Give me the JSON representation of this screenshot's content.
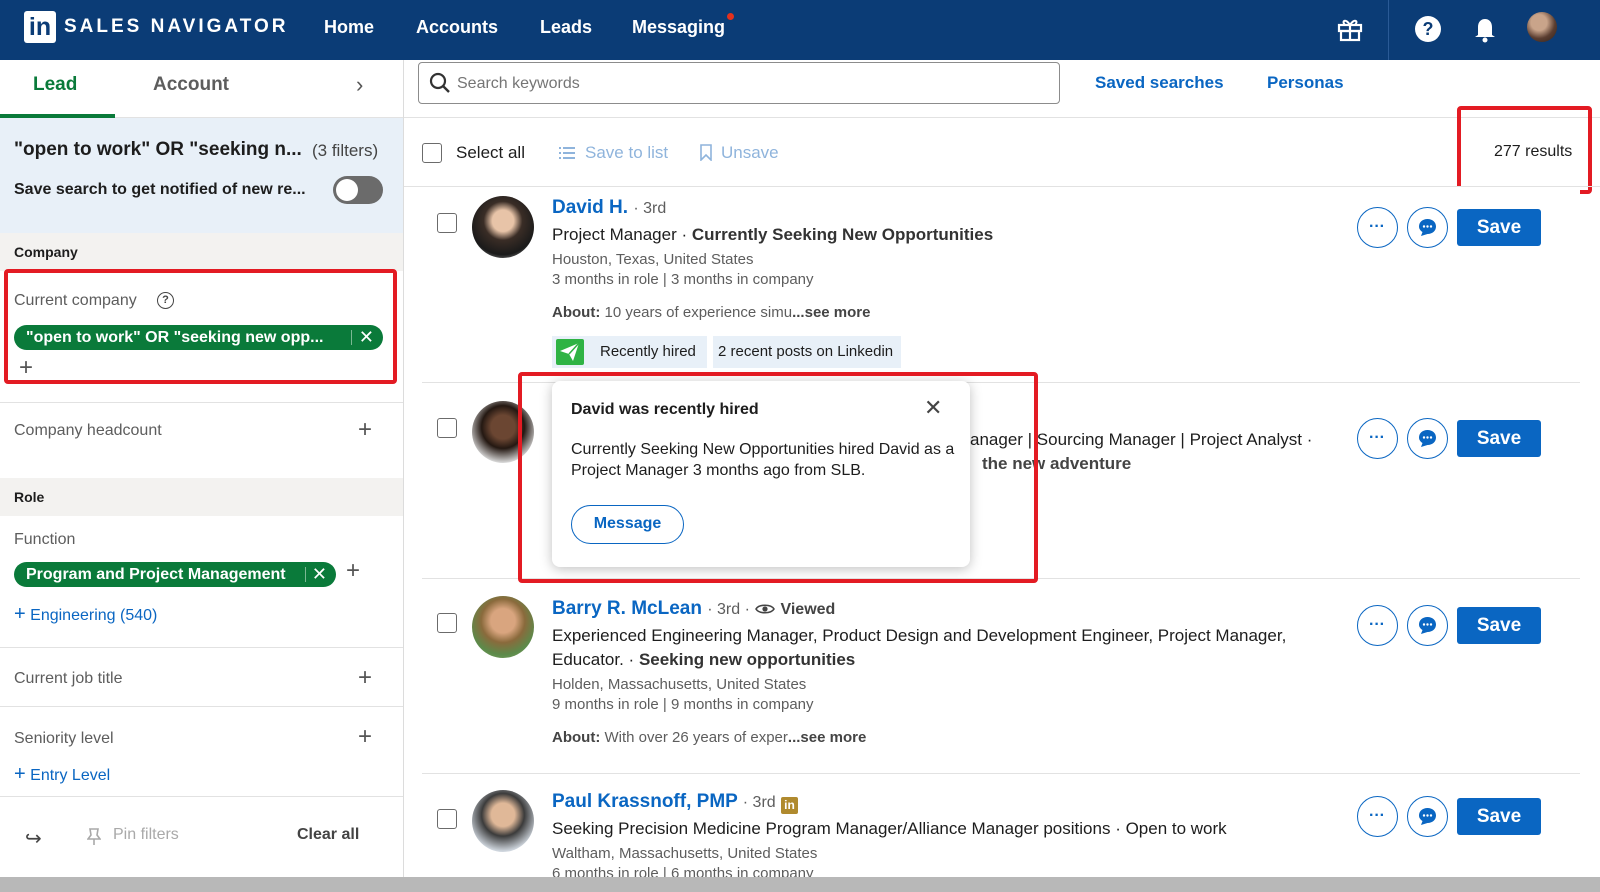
{
  "nav": {
    "logo": "in",
    "brand": "SALES NAVIGATOR",
    "links": [
      "Home",
      "Accounts",
      "Leads",
      "Messaging"
    ],
    "colors": {
      "bar": "#0b3c76",
      "accent_green": "#0a7a3a",
      "link_blue": "#0a66c2",
      "annotation_red": "#e31b23"
    },
    "icons": [
      "gift-icon",
      "help-icon",
      "bell-icon",
      "profile-avatar"
    ]
  },
  "left": {
    "tabs": [
      "Lead",
      "Account"
    ],
    "search_title": "\"open to work\" OR \"seeking n...",
    "filters_count": "(3 filters)",
    "save_search": "Save search to get notified of new re...",
    "company_section": "Company",
    "current_company_label": "Current company",
    "current_company_pill": "\"open to work\" OR \"seeking new opp...",
    "company_headcount": "Company headcount",
    "role_section": "Role",
    "function_label": "Function",
    "function_pill": "Program and Project Management",
    "engineering_link": "Engineering (540)",
    "current_job_title": "Current job title",
    "seniority_level": "Seniority level",
    "entry_level_link": "Entry Level",
    "pin_filters": "Pin filters",
    "clear_all": "Clear all"
  },
  "search": {
    "placeholder": "Search keywords",
    "saved_searches": "Saved searches",
    "personas": "Personas"
  },
  "actions": {
    "select_all": "Select all",
    "save_to_list": "Save to list",
    "unsave": "Unsave",
    "results": "277 results"
  },
  "leads": [
    {
      "name": "David H.",
      "degree": "· 3rd",
      "title": "Project Manager",
      "status": "Currently Seeking New Opportunities",
      "location": "Houston, Texas, United States",
      "tenure": "3 months in role | 3 months in company",
      "about_label": "About:",
      "about": "10 years of experience simu",
      "see_more": "...see more",
      "tag1": "Recently hired",
      "tag2": "2 recent posts on Linkedin"
    },
    {
      "headline_line1": "anager | Sourcing Manager | Project Analyst ·",
      "headline_line2": "the new adventure"
    },
    {
      "name": "Barry R. McLean",
      "degree": "· 3rd ·",
      "viewed": "Viewed",
      "title_line1": "Experienced Engineering Manager, Product Design and Development Engineer, Project Manager,",
      "title_line2": "Educator.",
      "status": "Seeking new opportunities",
      "location": "Holden, Massachusetts, United States",
      "tenure": "9 months in role | 9 months in company",
      "about_label": "About:",
      "about": "With over 26 years of exper",
      "see_more": "...see more"
    },
    {
      "name": "Paul Krassnoff, PMP",
      "degree": "· 3rd",
      "title": "Seeking Precision Medicine Program Manager/Alliance Manager positions",
      "status": "· Open to work",
      "location": "Waltham, Massachusetts, United States",
      "tenure": "6 months in role | 6 months in company"
    }
  ],
  "save_label": "Save",
  "popup": {
    "title": "David was recently hired",
    "body": "Currently Seeking New Opportunities hired David as a Project Manager 3 months ago from SLB.",
    "button": "Message"
  }
}
